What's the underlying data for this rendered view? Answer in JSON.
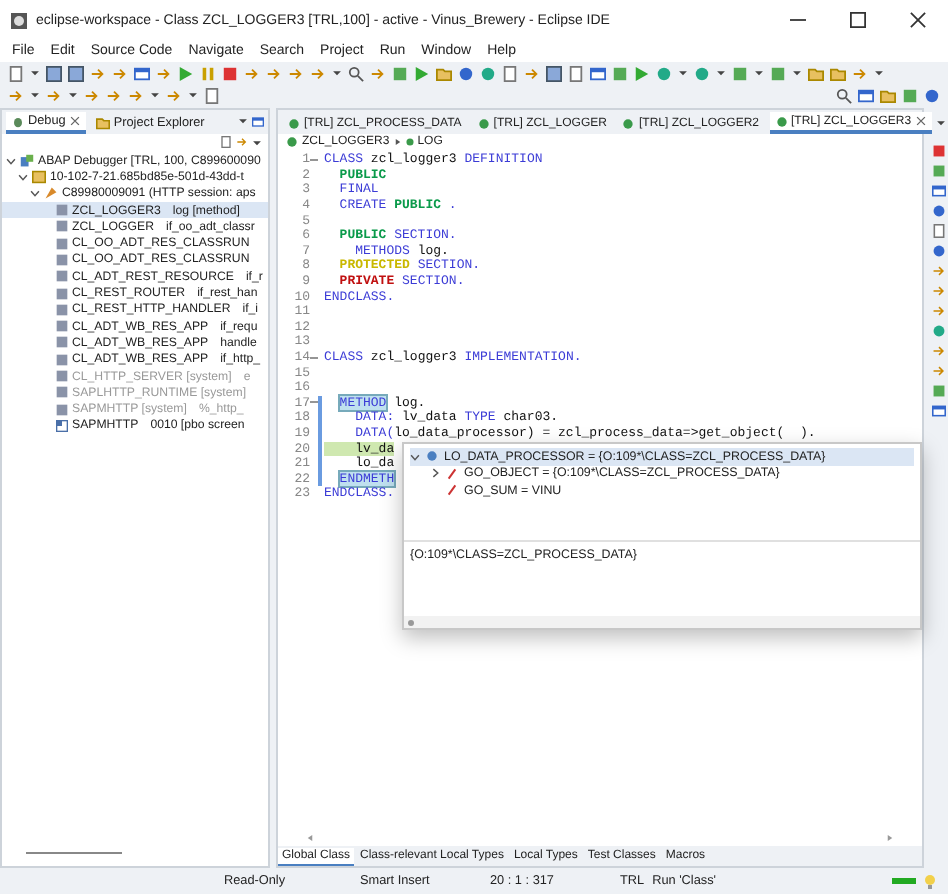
{
  "window": {
    "title": "eclipse-workspace - Class ZCL_LOGGER3 [TRL,100] - active - Vinus_Brewery - Eclipse IDE"
  },
  "menu": [
    "File",
    "Edit",
    "Source Code",
    "Navigate",
    "Search",
    "Project",
    "Run",
    "Window",
    "Help"
  ],
  "left_panel": {
    "tabs": [
      {
        "label": "Debug",
        "selected": true,
        "closable": true
      },
      {
        "label": "Project Explorer",
        "selected": false,
        "closable": false
      }
    ],
    "tree": [
      {
        "label": "ABAP Debugger [TRL, 100, C899600090",
        "kind": "debugger",
        "expanded": true,
        "selected": false,
        "children": [
          {
            "label": "10-102-7-21.685bd85e-501d-43dd-t",
            "kind": "thread",
            "expanded": true,
            "selected": false,
            "children": [
              {
                "label": "C89980009091 (HTTP session: aps",
                "kind": "session",
                "expanded": true,
                "selected": false,
                "children": [
                  {
                    "kind": "frame",
                    "name": "ZCL_LOGGER3",
                    "detail": "log [method]",
                    "selected": true,
                    "disabled": false
                  },
                  {
                    "kind": "frame",
                    "name": "ZCL_LOGGER",
                    "detail": "if_oo_adt_classr",
                    "selected": false,
                    "disabled": false
                  },
                  {
                    "kind": "frame",
                    "name": "CL_OO_ADT_RES_CLASSRUN",
                    "selected": false,
                    "disabled": false
                  },
                  {
                    "kind": "frame",
                    "name": "CL_OO_ADT_RES_CLASSRUN",
                    "selected": false,
                    "disabled": false
                  },
                  {
                    "kind": "frame",
                    "name": "CL_ADT_REST_RESOURCE",
                    "detail": "if_r",
                    "selected": false,
                    "disabled": false
                  },
                  {
                    "kind": "frame",
                    "name": "CL_REST_ROUTER",
                    "detail": "if_rest_han",
                    "selected": false,
                    "disabled": false
                  },
                  {
                    "kind": "frame",
                    "name": "CL_REST_HTTP_HANDLER",
                    "detail": "if_i",
                    "selected": false,
                    "disabled": false
                  },
                  {
                    "kind": "frame",
                    "name": "CL_ADT_WB_RES_APP",
                    "detail": "if_requ",
                    "selected": false,
                    "disabled": false
                  },
                  {
                    "kind": "frame",
                    "name": "CL_ADT_WB_RES_APP",
                    "detail": "handle",
                    "selected": false,
                    "disabled": false
                  },
                  {
                    "kind": "frame",
                    "name": "CL_ADT_WB_RES_APP",
                    "detail": "if_http_",
                    "selected": false,
                    "disabled": false
                  },
                  {
                    "kind": "frame",
                    "name": "CL_HTTP_SERVER [system]",
                    "detail": "e",
                    "selected": false,
                    "disabled": true
                  },
                  {
                    "kind": "frame",
                    "name": "SAPLHTTP_RUNTIME [system]",
                    "selected": false,
                    "disabled": true
                  },
                  {
                    "kind": "frame",
                    "name": "SAPMHTTP [system]",
                    "detail": "%_http_",
                    "selected": false,
                    "disabled": true
                  },
                  {
                    "kind": "screen",
                    "name": "SAPMHTTP",
                    "detail": "0010 [pbo screen",
                    "selected": false,
                    "disabled": false
                  }
                ]
              }
            ]
          }
        ]
      }
    ]
  },
  "editor": {
    "tabs": [
      {
        "label": "[TRL] ZCL_PROCESS_DATA",
        "selected": false,
        "closable": false
      },
      {
        "label": "[TRL] ZCL_LOGGER",
        "selected": false,
        "closable": false
      },
      {
        "label": "[TRL] ZCL_LOGGER2",
        "selected": false,
        "closable": false
      },
      {
        "label": "[TRL] ZCL_LOGGER3",
        "selected": true,
        "closable": true
      }
    ],
    "breadcrumb": [
      "ZCL_LOGGER3",
      "LOG"
    ],
    "lines": [
      {
        "n": "1",
        "fold": true,
        "tokens": [
          {
            "kind": "keyword",
            "text": "CLASS"
          },
          {
            "kind": "plain",
            "text": " zcl_logger3 "
          },
          {
            "kind": "keyword",
            "text": "DEFINITION"
          }
        ]
      },
      {
        "n": "2",
        "tokens": [
          {
            "kind": "access",
            "text": "  PUBLIC"
          }
        ]
      },
      {
        "n": "3",
        "tokens": [
          {
            "kind": "keyword",
            "text": "  FINAL"
          }
        ]
      },
      {
        "n": "4",
        "tokens": [
          {
            "kind": "keyword",
            "text": "  CREATE "
          },
          {
            "kind": "access",
            "text": "PUBLIC "
          },
          {
            "kind": "keyword",
            "text": "."
          }
        ]
      },
      {
        "n": "5"
      },
      {
        "n": "6",
        "tokens": [
          {
            "kind": "access",
            "text": "  PUBLIC "
          },
          {
            "kind": "keyword",
            "text": "SECTION."
          }
        ]
      },
      {
        "n": "7",
        "tokens": [
          {
            "kind": "keyword",
            "text": "    METHODS"
          },
          {
            "kind": "plain",
            "text": " log."
          }
        ]
      },
      {
        "n": "8",
        "tokens": [
          {
            "kind": "protected",
            "text": "  PROTECTED "
          },
          {
            "kind": "keyword",
            "text": "SECTION."
          }
        ]
      },
      {
        "n": "9",
        "tokens": [
          {
            "kind": "private",
            "text": "  PRIVATE "
          },
          {
            "kind": "keyword",
            "text": "SECTION."
          }
        ]
      },
      {
        "n": "10",
        "tokens": [
          {
            "kind": "keyword",
            "text": "ENDCLASS."
          }
        ]
      },
      {
        "n": "11"
      },
      {
        "n": "12"
      },
      {
        "n": "13"
      },
      {
        "n": "14",
        "fold": true,
        "tokens": [
          {
            "kind": "keyword",
            "text": "CLASS"
          },
          {
            "kind": "plain",
            "text": " zcl_logger3 "
          },
          {
            "kind": "keyword",
            "text": "IMPLEMENTATION."
          }
        ]
      },
      {
        "n": "15"
      },
      {
        "n": "16"
      },
      {
        "n": "17",
        "fold": true,
        "in_range": true,
        "tokens": [
          {
            "kind": "occurrence",
            "text": "METHOD"
          },
          {
            "kind": "plain",
            "text": " log."
          }
        ]
      },
      {
        "n": "18",
        "in_range": true,
        "tokens": [
          {
            "kind": "keyword",
            "text": "    DATA:"
          },
          {
            "kind": "plain",
            "text": " lv_data "
          },
          {
            "kind": "keyword",
            "text": "TYPE"
          },
          {
            "kind": "plain",
            "text": " char03."
          }
        ]
      },
      {
        "n": "19",
        "in_range": true,
        "tokens": [
          {
            "kind": "keyword",
            "text": "    DATA("
          },
          {
            "kind": "plain",
            "text": "lo_data_processor) = zcl_process_data=>get_object(  )."
          }
        ]
      },
      {
        "n": "20",
        "current": true,
        "in_range": true,
        "tokens": [
          {
            "kind": "plain",
            "text": "    lv_da"
          }
        ]
      },
      {
        "n": "21",
        "in_range": true,
        "tokens": [
          {
            "kind": "plain",
            "text": "    lo_da"
          }
        ]
      },
      {
        "n": "22",
        "in_range": true,
        "tokens": [
          {
            "kind": "occurrence",
            "text": "ENDMETH"
          }
        ]
      },
      {
        "n": "23",
        "tokens": [
          {
            "kind": "keyword",
            "text": "ENDCLASS."
          }
        ]
      }
    ],
    "debug_hover": {
      "tree": [
        {
          "label": "LO_DATA_PROCESSOR = {O:109*\\CLASS=ZCL_PROCESS_DATA}",
          "kind": "object",
          "expanded": true,
          "selected": true,
          "children": [
            {
              "label": "GO_OBJECT = {O:109*\\CLASS=ZCL_PROCESS_DATA}",
              "kind": "attribute",
              "expanded": false,
              "selected": false
            },
            {
              "label": "GO_SUM = VINU",
              "kind": "attribute",
              "selected": false
            }
          ]
        }
      ],
      "detail": "{O:109*\\CLASS=ZCL_PROCESS_DATA}"
    },
    "bottom_tabs": [
      {
        "label": "Global Class",
        "selected": true
      },
      {
        "label": "Class-relevant Local Types",
        "selected": false
      },
      {
        "label": "Local Types",
        "selected": false
      },
      {
        "label": "Test Classes",
        "selected": false
      },
      {
        "label": "Macros",
        "selected": false
      }
    ]
  },
  "status_bar": {
    "mode": "Read-Only",
    "insert": "Smart Insert",
    "position": "20 : 1 : 317",
    "system": "TRL",
    "action": "Run 'Class'"
  }
}
